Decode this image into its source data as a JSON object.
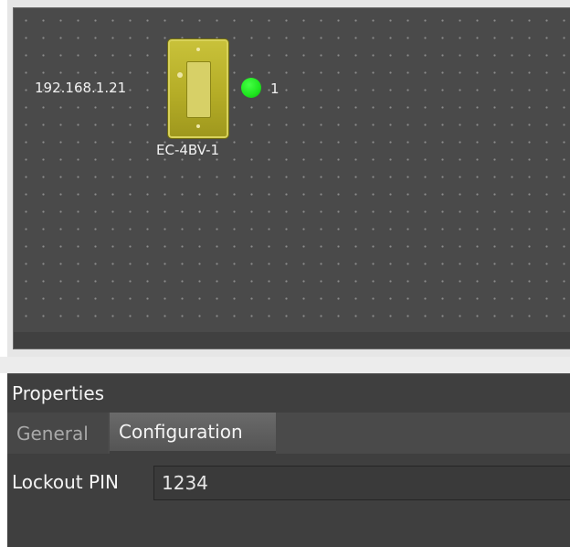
{
  "canvas": {
    "device": {
      "ip_address": "192.168.1.21",
      "name": "EC-4BV-1",
      "status_count": "1",
      "status_color": "#22e622",
      "body_color": "#b5ad27",
      "icon": "wall-station-icon"
    }
  },
  "properties": {
    "title": "Properties",
    "tabs": [
      {
        "label": "General",
        "active": false
      },
      {
        "label": "Configuration",
        "active": true
      }
    ],
    "fields": [
      {
        "label": "Lockout PIN",
        "value": "1234"
      }
    ]
  }
}
